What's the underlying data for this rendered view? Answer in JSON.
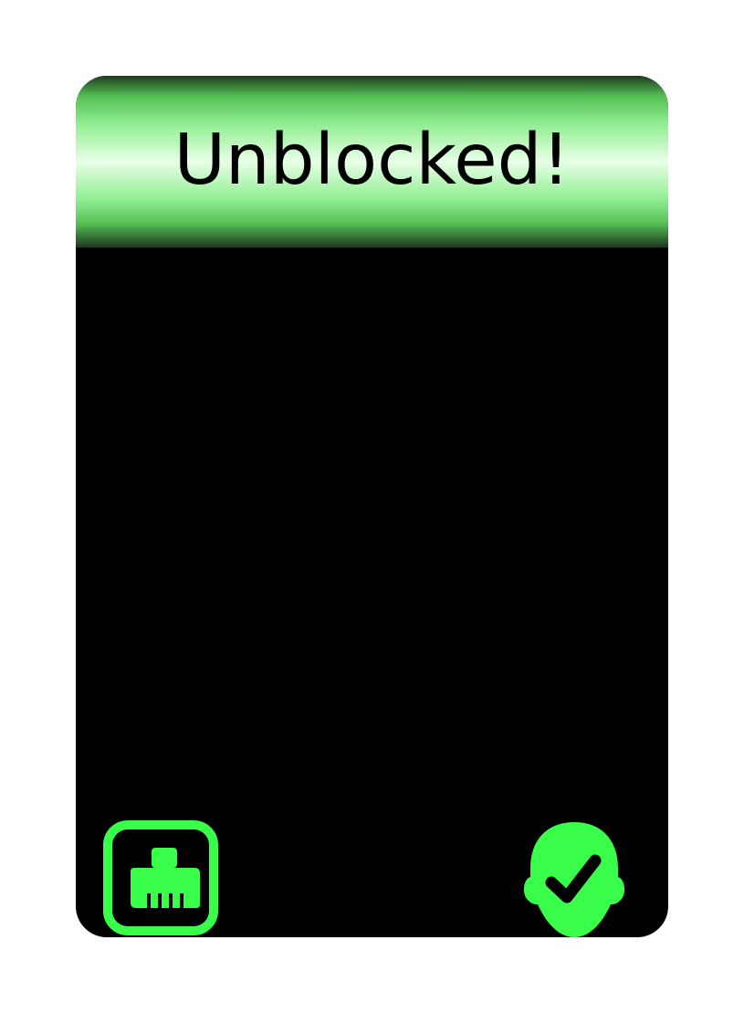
{
  "banner": {
    "title": "Unblocked!"
  },
  "icons": {
    "left": "ethernet-port-icon",
    "right": "verified-user-check-icon"
  },
  "colors": {
    "accent": "#39ff4a",
    "card_background": "#000000",
    "banner_highlight": "#e8ffe8",
    "banner_mid": "#90ee90"
  }
}
